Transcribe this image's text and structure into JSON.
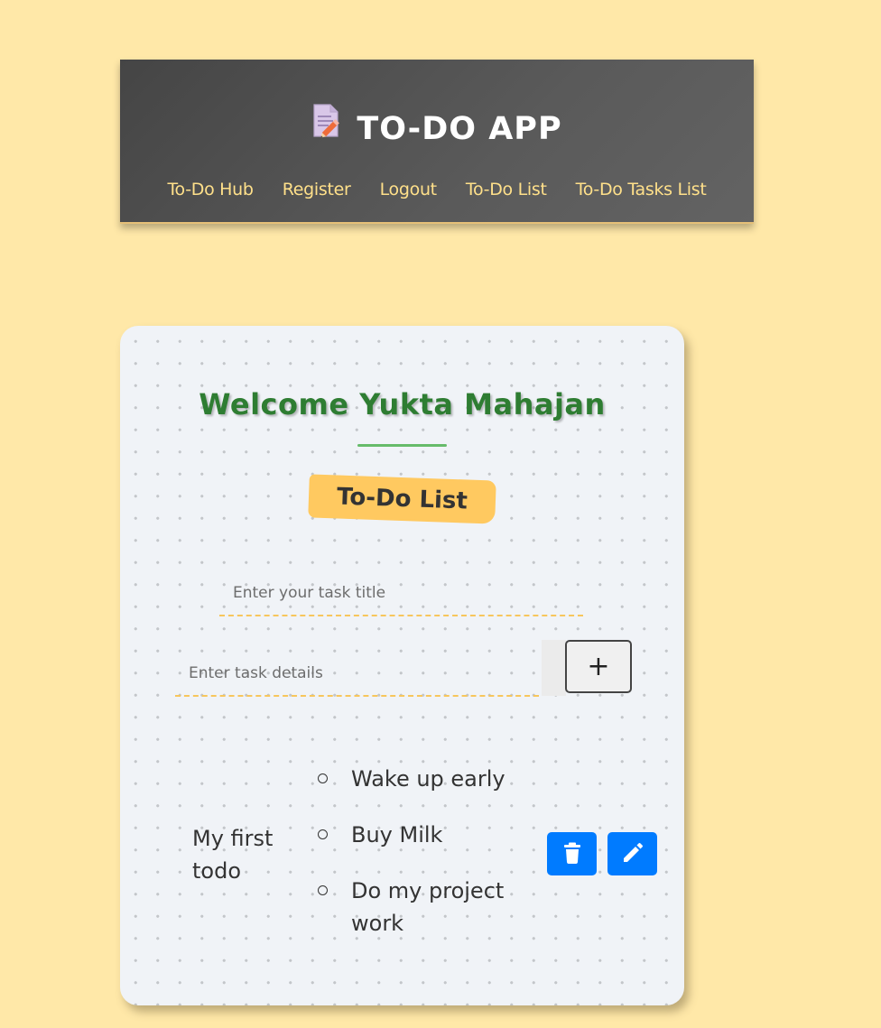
{
  "header": {
    "title": "TO-DO APP",
    "title_icon": "memo-icon",
    "nav": [
      "To-Do Hub",
      "Register",
      "Logout",
      "To-Do List",
      "To-Do Tasks List"
    ]
  },
  "card": {
    "welcome": "Welcome Yukta Mahajan",
    "section_label": "To-Do List",
    "title_input": {
      "placeholder": "Enter your task title",
      "value": ""
    },
    "details_input": {
      "placeholder": "Enter task details",
      "value": ""
    },
    "add_button_label": "+",
    "todo": {
      "title": "My first todo",
      "tasks": [
        "Wake up early",
        "Buy Milk",
        "Do my project work"
      ],
      "actions": {
        "delete_icon": "trash-icon",
        "edit_icon": "pencil-icon"
      }
    }
  },
  "colors": {
    "page_background": "#ffe8a8",
    "header_background": "#505050",
    "nav_link": "#ffe08a",
    "welcome_text": "#2e7d32",
    "badge": "#ffc960",
    "action_button": "#007bff",
    "input_underline": "#f7c65c"
  }
}
